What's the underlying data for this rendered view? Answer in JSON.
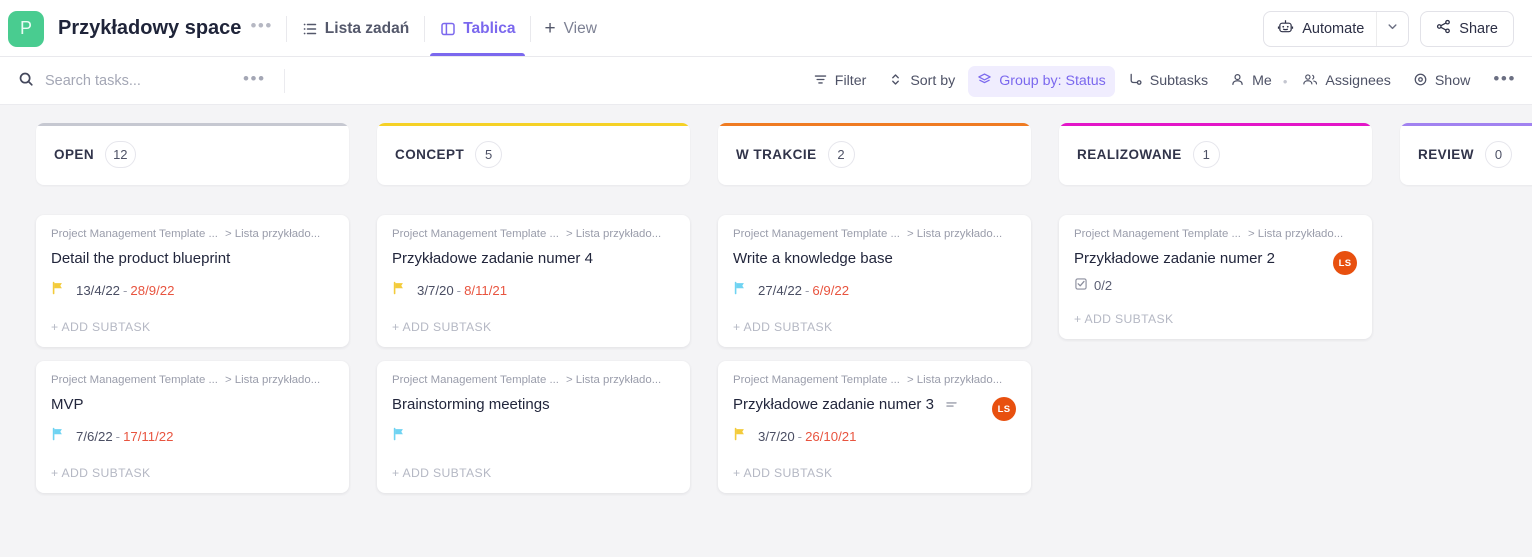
{
  "header": {
    "space_initial": "P",
    "space_name": "Przykładowy space",
    "space_menu_dots": "•••",
    "views": [
      {
        "label": "Lista zadań",
        "icon": "list-icon",
        "active": false
      },
      {
        "label": "Tablica",
        "icon": "board-icon",
        "active": true
      }
    ],
    "add_view_label": "View",
    "add_view_plus": "+",
    "automate_label": "Automate",
    "share_label": "Share",
    "colors": {
      "space_logo_bg": "#49cc90",
      "accent_purple": "#7b68ee"
    }
  },
  "toolbar": {
    "search_placeholder": "Search tasks...",
    "search_value": "",
    "dots": "•••",
    "items": [
      {
        "label": "Filter",
        "icon": "filter-icon",
        "active": false
      },
      {
        "label": "Sort by",
        "icon": "sort-icon",
        "active": false
      },
      {
        "label": "Group by: Status",
        "icon": "layers-icon",
        "active": true
      },
      {
        "label": "Subtasks",
        "icon": "subtask-icon",
        "active": false
      },
      {
        "label": "Me",
        "icon": "person-icon",
        "active": false
      },
      {
        "label": "Assignees",
        "icon": "people-icon",
        "active": false
      },
      {
        "label": "Show",
        "icon": "eye-icon",
        "active": false
      }
    ],
    "separator_dot": "•",
    "more_dots": "•••"
  },
  "board": {
    "add_subtask_label": "+ ADD SUBTASK",
    "columns": [
      {
        "title": "OPEN",
        "count": "12",
        "accent": "#c6c8d1",
        "cards": [
          {
            "crumb1": "Project Management Template ...",
            "crumb2": "> Lista przykłado...",
            "title": "Detail the product blueprint",
            "flag_color": "#f3cb3b",
            "start_date": "13/4/22",
            "date_sep": "-",
            "end_date": "28/9/22",
            "end_overdue": true
          },
          {
            "crumb1": "Project Management Template ...",
            "crumb2": "> Lista przykłado...",
            "title": "MVP",
            "flag_color": "#6fd3f2",
            "start_date": "7/6/22",
            "date_sep": "-",
            "end_date": "17/11/22",
            "end_overdue": true
          }
        ]
      },
      {
        "title": "CONCEPT",
        "count": "5",
        "accent": "#f5d126",
        "cards": [
          {
            "crumb1": "Project Management Template ...",
            "crumb2": "> Lista przykłado...",
            "title": "Przykładowe zadanie numer 4",
            "flag_color": "#f3cb3b",
            "start_date": "3/7/20",
            "date_sep": "-",
            "end_date": "8/11/21",
            "end_overdue": true
          },
          {
            "crumb1": "Project Management Template ...",
            "crumb2": "> Lista przykłado...",
            "title": "Brainstorming meetings",
            "flag_color": "#6fd3f2",
            "start_date": "",
            "date_sep": "",
            "end_date": "",
            "end_overdue": false
          }
        ]
      },
      {
        "title": "W TRAKCIE",
        "count": "2",
        "accent": "#ef7b22",
        "cards": [
          {
            "crumb1": "Project Management Template ...",
            "crumb2": "> Lista przykłado...",
            "title": "Write a knowledge base",
            "flag_color": "#6fd3f2",
            "start_date": "27/4/22",
            "date_sep": "-",
            "end_date": "6/9/22",
            "end_overdue": true
          },
          {
            "crumb1": "Project Management Template ...",
            "crumb2": "> Lista przykłado...",
            "title": "Przykładowe zadanie numer 3",
            "priority_icon": "equals-icon",
            "avatar_initials": "LS",
            "avatar_color": "#e8500f",
            "flag_color": "#f3cb3b",
            "start_date": "3/7/20",
            "date_sep": "-",
            "end_date": "26/10/21",
            "end_overdue": true
          }
        ]
      },
      {
        "title": "REALIZOWANE",
        "count": "1",
        "accent": "#e316c8",
        "cards": [
          {
            "crumb1": "Project Management Template ...",
            "crumb2": "> Lista przykłado...",
            "title": "Przykładowe zadanie numer 2",
            "avatar_initials": "LS",
            "avatar_color": "#e8500f",
            "checklist": "0/2"
          }
        ]
      },
      {
        "title": "REVIEW",
        "count": "0",
        "accent": "#a182f0",
        "cards": []
      }
    ]
  }
}
